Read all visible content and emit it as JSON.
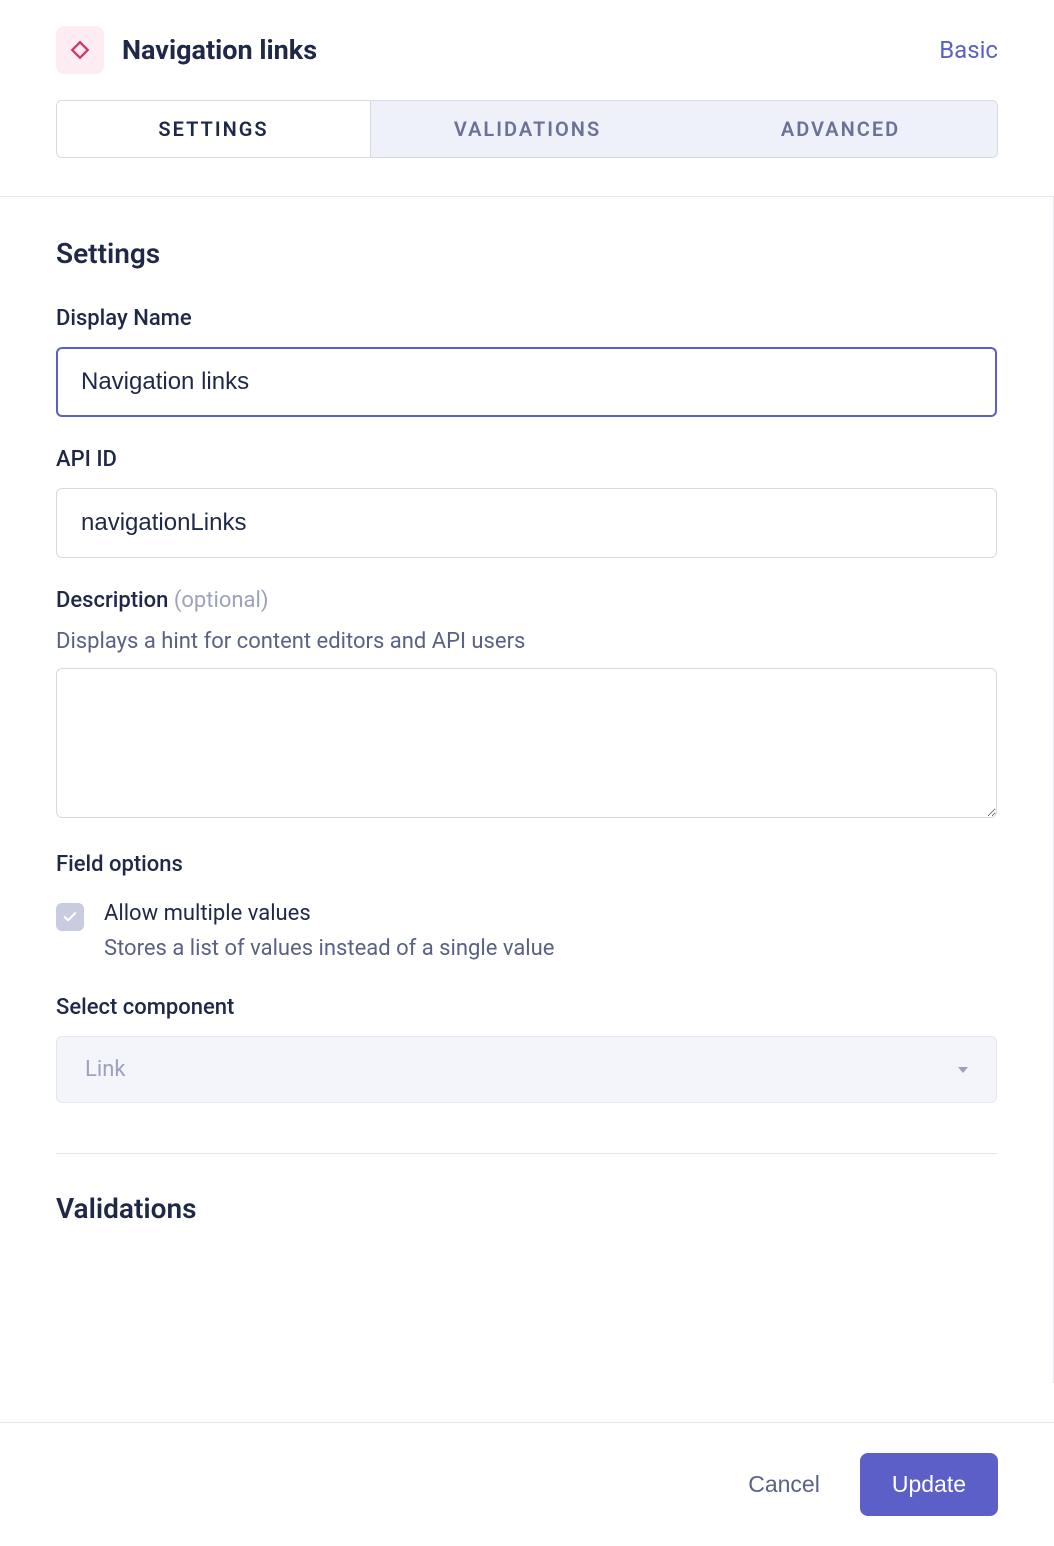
{
  "header": {
    "title": "Navigation links",
    "type_label": "Basic",
    "icon": "diamond-icon"
  },
  "tabs": {
    "settings": "SETTINGS",
    "validations": "VALIDATIONS",
    "advanced": "ADVANCED"
  },
  "settings": {
    "heading": "Settings",
    "display_name": {
      "label": "Display Name",
      "value": "Navigation links"
    },
    "api_id": {
      "label": "API ID",
      "value": "navigationLinks"
    },
    "description": {
      "label": "Description ",
      "optional": "(optional)",
      "hint": "Displays a hint for content editors and API users",
      "value": ""
    },
    "field_options": {
      "label": "Field options",
      "allow_multiple": {
        "label": "Allow multiple values",
        "hint": "Stores a list of values instead of a single value",
        "checked": true
      }
    },
    "select_component": {
      "label": "Select component",
      "value": "Link"
    }
  },
  "validations": {
    "heading": "Validations"
  },
  "footer": {
    "cancel": "Cancel",
    "update": "Update"
  }
}
